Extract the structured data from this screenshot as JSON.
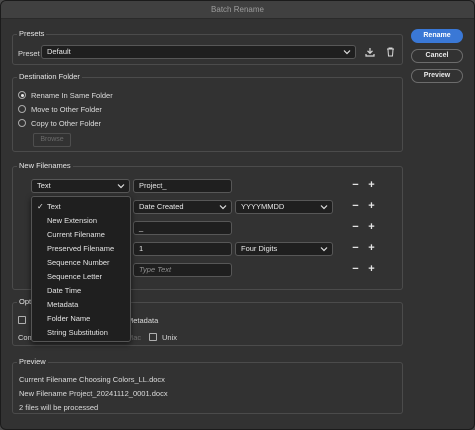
{
  "window": {
    "title": "Batch Rename"
  },
  "presets": {
    "group_title": "Presets",
    "preset_label": "Preset",
    "preset_value": "Default"
  },
  "destination": {
    "group_title": "Destination Folder",
    "options": [
      "Rename In Same Folder",
      "Move to Other Folder",
      "Copy to Other Folder"
    ],
    "selected_index": 0,
    "browse_label": "Browse"
  },
  "filenames": {
    "group_title": "New Filenames",
    "rows": [
      {
        "type": "Text",
        "value": "Project_"
      },
      {
        "type": "Date Time",
        "value": "Date Created",
        "format": "YYYYMMDD"
      },
      {
        "type": "Text",
        "value": "_"
      },
      {
        "type": "Sequence Number",
        "value": "1",
        "format": "Four Digits"
      },
      {
        "type": "Text",
        "value": "",
        "placeholder": "Type Text"
      }
    ],
    "dropdown": {
      "items": [
        "Text",
        "New Extension",
        "Current Filename",
        "Preserved Filename",
        "Sequence Number",
        "Sequence Letter",
        "Date Time",
        "Metadata",
        "Folder Name",
        "String Substitution"
      ],
      "selected": "Text"
    }
  },
  "options": {
    "group_title": "Opti",
    "metadata_label": "Metadata",
    "compat_label": "Com",
    "mac_label": "Mac",
    "unix_label": "Unix"
  },
  "preview": {
    "group_title": "Preview",
    "current_filename": "Current Filename Choosing Colors_LL.docx",
    "new_filename": "New Filename Project_20241112_0001.docx",
    "files_processed": "2 files will be processed"
  },
  "actions": {
    "rename": "Rename",
    "cancel": "Cancel",
    "preview": "Preview"
  },
  "colors": {
    "accent": "#3a78d6",
    "background": "#323232",
    "field": "#1f1f1f"
  }
}
